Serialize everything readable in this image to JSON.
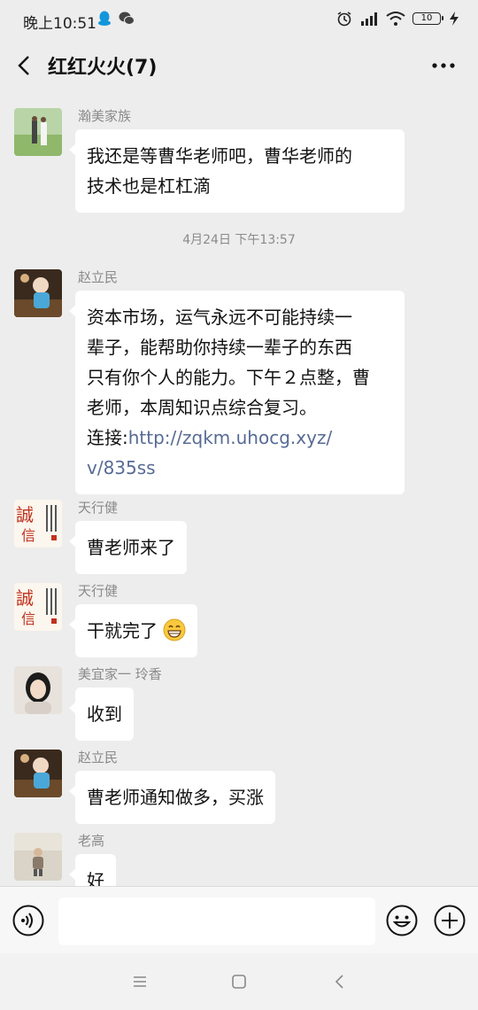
{
  "status_bar": {
    "time": "晚上10:51",
    "battery": "10",
    "icons": [
      "qq-icon",
      "wechat-icon",
      "alarm-icon",
      "hd-signal-icon",
      "wifi-icon",
      "battery-icon",
      "charging-icon"
    ]
  },
  "header": {
    "title": "红红火火(7)",
    "back_icon": "chevron-left-icon",
    "more_icon": "more-dots-icon"
  },
  "messages": [
    {
      "sender": "瀚美家族",
      "lines": [
        "我还是等曹华老师吧，曹华老师的",
        "技术也是杠杠滴"
      ]
    },
    {
      "timestamp": "4月24日 下午13:57"
    },
    {
      "sender": "赵立民",
      "lines": [
        "资本市场，运气永远不可能持续一",
        "辈子，能帮助你持续一辈子的东西",
        "只有你个人的能力。下午２点整，曹",
        "老师，本周知识点综合复习。"
      ],
      "link_prefix": "连接:",
      "link_line1": "http://zqkm.uhocg.xyz/",
      "link_line2": "v/835ss"
    },
    {
      "sender": "天行健",
      "text": "曹老师来了"
    },
    {
      "sender": "天行健",
      "text": "干就完了",
      "emoji": "grin-emoji"
    },
    {
      "sender": "美宜家一 玲香",
      "text": "收到"
    },
    {
      "sender": "赵立民",
      "text": "曹老师通知做多，买涨"
    },
    {
      "sender": "老高",
      "text": "好"
    }
  ],
  "input_bar": {
    "placeholder": ""
  },
  "colors": {
    "background": "#ededed",
    "bubble": "#ffffff",
    "link": "#576b95",
    "meta_text": "#8a8a8a"
  }
}
